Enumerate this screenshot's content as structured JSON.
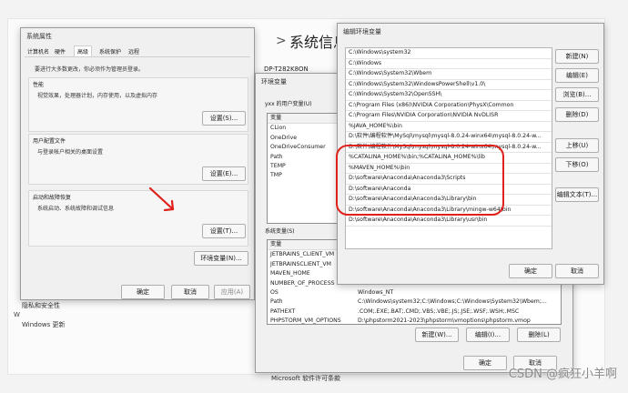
{
  "background": {
    "right_panel": {
      "path_sep": ">",
      "title": "系统信息"
    },
    "computer_name": "DP-T282K8ON",
    "left_items": [
      "隐私和安全性",
      "Windows 更新"
    ],
    "bottom_label": "Microsoft 软件许可条款",
    "extra_label": "W"
  },
  "sysprops": {
    "title": "系统属性",
    "tabs": [
      "计算机名",
      "硬件",
      "高级",
      "系统保护",
      "远程"
    ],
    "admin_note": "要进行大多数更改，你必须作为管理员登录。",
    "perf": {
      "title": "性能",
      "desc": "视觉效果，处理器计划，内存使用，以及虚拟内存",
      "button": "设置(S)..."
    },
    "profile": {
      "title": "用户配置文件",
      "desc": "与登录帐户相关的桌面设置",
      "button": "设置(E)..."
    },
    "startup": {
      "title": "启动和故障恢复",
      "desc": "系统启动、系统故障和调试信息",
      "button": "设置(T)..."
    },
    "env_button": "环境变量(N)...",
    "ok": "确定",
    "cancel": "取消",
    "apply": "应用(A)"
  },
  "envvars": {
    "title": "环境变量",
    "user_label": "yxx 的用户变量(U)",
    "user_header": "变量",
    "user_vars": [
      "CLion",
      "OneDrive",
      "OneDriveConsumer",
      "Path",
      "TEMP",
      "TMP"
    ],
    "sys_label": "系统变量(S)",
    "sys_header": {
      "name": "变量",
      "value": "值"
    },
    "sys_vars": [
      {
        "name": "JETBRAINS_CLIENT_VM",
        "value": ""
      },
      {
        "name": "JETBRAINSCLIENT_VM",
        "value": ""
      },
      {
        "name": "MAVEN_HOME",
        "value": ""
      },
      {
        "name": "NUMBER_OF_PROCESS",
        "value": ""
      },
      {
        "name": "OS",
        "value": "Windows_NT"
      },
      {
        "name": "Path",
        "value": "C:\\Windows\\system32;C:\\Windows;C:\\Windows\\System32\\Wbem;..."
      },
      {
        "name": "PATHEXT",
        "value": ".COM;.EXE;.BAT;.CMD;.VBS;.VBE;.JS;.JSE;.WSF;.WSH;.MSC"
      },
      {
        "name": "PHPSTORM_VM_OPTIONS",
        "value": "D:\\phpstorm2021-2023\\phpstorm\\vmoptions\\phpstorm.vmop"
      }
    ],
    "new_btn": "新建(W)...",
    "edit_btn": "编辑(I)...",
    "delete_btn": "删除(L)",
    "ok": "确定",
    "cancel": "取消"
  },
  "editenv": {
    "title": "编辑环境变量",
    "paths": [
      "C:\\Windows\\system32",
      "C:\\Windows",
      "C:\\Windows\\System32\\Wbem",
      "C:\\Windows\\System32\\WindowsPowerShell\\v1.0\\",
      "C:\\Windows\\System32\\OpenSSH\\",
      "C:\\Program Files (x86)\\NVIDIA Corporation\\PhysX\\Common",
      "C:\\Program Files\\NVIDIA Corporation\\NVIDIA NvDLISR",
      "%JAVA_HOME%\\bin",
      "D:\\软件\\编程软件\\MySql\\mysql\\mysql-8.0.24-winx64\\mysql-8.0.24-w...",
      "D:\\软件\\编程软件\\MySql\\mysql\\mysql-8.0.24-winx64\\mysql-8.0.24-w...",
      "%CATALINA_HOME%\\bin;%CATALINA_HOME%\\lib",
      "%MAVEN_HOME%\\bin",
      "D:\\software\\Anaconda\\Anaconda3\\Scripts",
      "D:\\software\\Anaconda",
      "D:\\software\\Anaconda\\Anaconda3\\Library\\bin",
      "D:\\software\\Anaconda\\Anaconda3\\Library\\mingw-w64\\bin",
      "D:\\software\\Anaconda\\Anaconda3\\Library\\usr\\bin"
    ],
    "new_btn": "新建(N)",
    "edit_btn": "编辑(E)",
    "browse_btn": "浏览(B)...",
    "delete_btn": "删除(D)",
    "up_btn": "上移(U)",
    "down_btn": "下移(O)",
    "edit_text_btn": "编辑文本(T)...",
    "ok": "确定",
    "cancel": "取消"
  },
  "watermark": "CSDN @疯狂小羊啊",
  "colors": {
    "selection": "#0078d7",
    "annotation_red": "#e0201b"
  }
}
